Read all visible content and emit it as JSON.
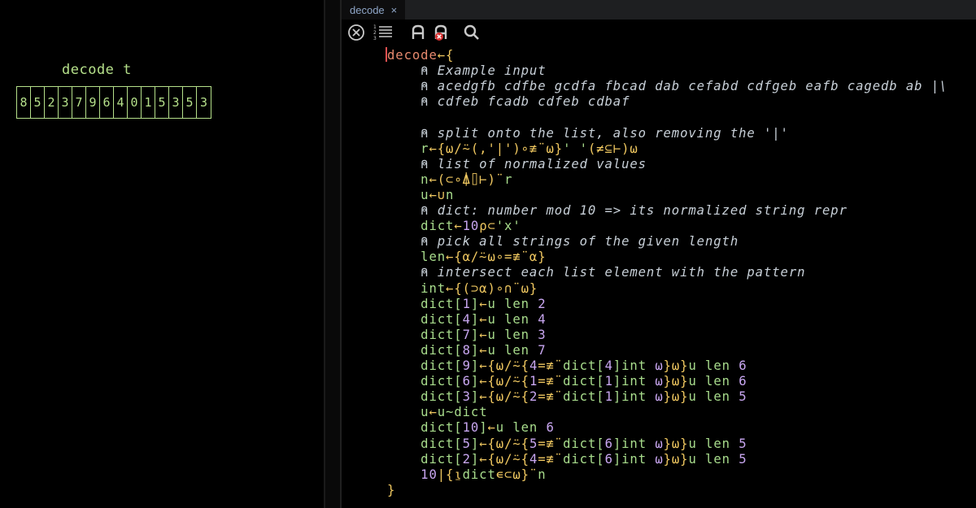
{
  "session": {
    "title": "decode t",
    "digits": [
      "8",
      "5",
      "2",
      "3",
      "7",
      "9",
      "6",
      "4",
      "0",
      "1",
      "5",
      "3",
      "5",
      "3"
    ]
  },
  "editor": {
    "tab_label": "decode",
    "tab_close": "×",
    "toolbar_icons": [
      "close-circle-icon",
      "line-numbers-icon",
      "font-icon",
      "font-remove-icon",
      "search-icon"
    ],
    "code_lines": [
      [
        [
          "fn",
          "decode"
        ],
        [
          "op",
          "←{"
        ]
      ],
      [
        [
          "cmt",
          "    ⍝ Example input"
        ]
      ],
      [
        [
          "cmt",
          "    ⍝ acedgfb cdfbe gcdfa fbcad dab cefabd cdfgeb eafb cagedb ab |\\"
        ]
      ],
      [
        [
          "cmt",
          "    ⍝ cdfeb fcadb cdfeb cdbaf"
        ]
      ],
      [],
      [
        [
          "cmt",
          "    ⍝ split onto the list, also removing the '|'"
        ]
      ],
      [
        [
          "txt",
          "    r"
        ],
        [
          "op",
          "←{⍵/⍨(,'|')∘≢¨⍵}"
        ],
        [
          "str",
          "' '"
        ],
        [
          "op",
          "(≠⊆⊢)⍵"
        ]
      ],
      [
        [
          "cmt",
          "    ⍝ list of normalized values"
        ]
      ],
      [
        [
          "txt",
          "    n"
        ],
        [
          "op",
          "←(⊂∘⍋⌷⊢)¨"
        ],
        [
          "txt",
          "r"
        ]
      ],
      [
        [
          "txt",
          "    u"
        ],
        [
          "op",
          "←∪"
        ],
        [
          "txt",
          "n"
        ]
      ],
      [
        [
          "cmt",
          "    ⍝ dict: number mod 10 => its normalized string repr"
        ]
      ],
      [
        [
          "txt",
          "    dict"
        ],
        [
          "op",
          "←"
        ],
        [
          "num",
          "10"
        ],
        [
          "op",
          "⍴⊂"
        ],
        [
          "str",
          "'x'"
        ]
      ],
      [
        [
          "cmt",
          "    ⍝ pick all strings of the given length"
        ]
      ],
      [
        [
          "txt",
          "    len"
        ],
        [
          "op",
          "←{⍺/⍨⍵∘=≢¨⍺}"
        ]
      ],
      [
        [
          "cmt",
          "    ⍝ intersect each list element with the pattern"
        ]
      ],
      [
        [
          "txt",
          "    int"
        ],
        [
          "op",
          "←{(⊃⍺)∘∩¨⍵}"
        ]
      ],
      [
        [
          "txt",
          "    dict["
        ],
        [
          "idx",
          "1"
        ],
        [
          "txt",
          "]"
        ],
        [
          "op",
          "←"
        ],
        [
          "txt",
          "u len "
        ],
        [
          "num",
          "2"
        ]
      ],
      [
        [
          "txt",
          "    dict["
        ],
        [
          "idx",
          "4"
        ],
        [
          "txt",
          "]"
        ],
        [
          "op",
          "←"
        ],
        [
          "txt",
          "u len "
        ],
        [
          "num",
          "4"
        ]
      ],
      [
        [
          "txt",
          "    dict["
        ],
        [
          "idx",
          "7"
        ],
        [
          "txt",
          "]"
        ],
        [
          "op",
          "←"
        ],
        [
          "txt",
          "u len "
        ],
        [
          "num",
          "3"
        ]
      ],
      [
        [
          "txt",
          "    dict["
        ],
        [
          "idx",
          "8"
        ],
        [
          "txt",
          "]"
        ],
        [
          "op",
          "←"
        ],
        [
          "txt",
          "u len "
        ],
        [
          "num",
          "7"
        ]
      ],
      [
        [
          "txt",
          "    dict["
        ],
        [
          "idx",
          "9"
        ],
        [
          "txt",
          "]"
        ],
        [
          "op",
          "←{⍵/⍨{"
        ],
        [
          "num",
          "4"
        ],
        [
          "op",
          "=≢¨"
        ],
        [
          "txt",
          "dict["
        ],
        [
          "idx",
          "4"
        ],
        [
          "txt",
          "]int "
        ],
        [
          "vv",
          "⍵"
        ],
        [
          "op",
          "}⍵}"
        ],
        [
          "txt",
          "u len "
        ],
        [
          "num",
          "6"
        ]
      ],
      [
        [
          "txt",
          "    dict["
        ],
        [
          "idx",
          "6"
        ],
        [
          "txt",
          "]"
        ],
        [
          "op",
          "←{⍵/⍨{"
        ],
        [
          "num",
          "1"
        ],
        [
          "op",
          "=≢¨"
        ],
        [
          "txt",
          "dict["
        ],
        [
          "idx",
          "1"
        ],
        [
          "txt",
          "]int "
        ],
        [
          "vv",
          "⍵"
        ],
        [
          "op",
          "}⍵}"
        ],
        [
          "txt",
          "u len "
        ],
        [
          "num",
          "6"
        ]
      ],
      [
        [
          "txt",
          "    dict["
        ],
        [
          "idx",
          "3"
        ],
        [
          "txt",
          "]"
        ],
        [
          "op",
          "←{⍵/⍨{"
        ],
        [
          "num",
          "2"
        ],
        [
          "op",
          "=≢¨"
        ],
        [
          "txt",
          "dict["
        ],
        [
          "idx",
          "1"
        ],
        [
          "txt",
          "]int "
        ],
        [
          "vv",
          "⍵"
        ],
        [
          "op",
          "}⍵}"
        ],
        [
          "txt",
          "u len "
        ],
        [
          "num",
          "5"
        ]
      ],
      [
        [
          "txt",
          "    u"
        ],
        [
          "op",
          "←"
        ],
        [
          "txt",
          "u~dict"
        ]
      ],
      [
        [
          "txt",
          "    dict["
        ],
        [
          "idx",
          "10"
        ],
        [
          "txt",
          "]"
        ],
        [
          "op",
          "←"
        ],
        [
          "txt",
          "u len "
        ],
        [
          "num",
          "6"
        ]
      ],
      [
        [
          "txt",
          "    dict["
        ],
        [
          "idx",
          "5"
        ],
        [
          "txt",
          "]"
        ],
        [
          "op",
          "←{⍵/⍨{"
        ],
        [
          "num",
          "5"
        ],
        [
          "op",
          "=≢¨"
        ],
        [
          "txt",
          "dict["
        ],
        [
          "idx",
          "6"
        ],
        [
          "txt",
          "]int "
        ],
        [
          "vv",
          "⍵"
        ],
        [
          "op",
          "}⍵}"
        ],
        [
          "txt",
          "u len "
        ],
        [
          "num",
          "5"
        ]
      ],
      [
        [
          "txt",
          "    dict["
        ],
        [
          "idx",
          "2"
        ],
        [
          "txt",
          "]"
        ],
        [
          "op",
          "←{⍵/⍨{"
        ],
        [
          "num",
          "4"
        ],
        [
          "op",
          "=≢¨"
        ],
        [
          "txt",
          "dict["
        ],
        [
          "idx",
          "6"
        ],
        [
          "txt",
          "]int "
        ],
        [
          "vv",
          "⍵"
        ],
        [
          "op",
          "}⍵}"
        ],
        [
          "txt",
          "u len "
        ],
        [
          "num",
          "5"
        ]
      ],
      [
        [
          "num",
          "    10"
        ],
        [
          "op",
          "|{⍸"
        ],
        [
          "txt",
          "dict"
        ],
        [
          "op",
          "∊⊂⍵}¨"
        ],
        [
          "txt",
          "n"
        ]
      ],
      [
        [
          "op",
          "}"
        ]
      ]
    ]
  }
}
